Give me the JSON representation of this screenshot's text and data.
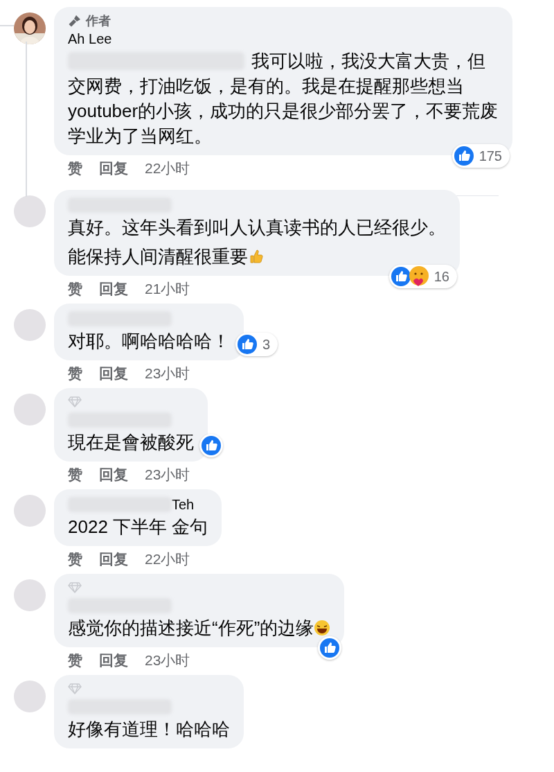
{
  "comments": [
    {
      "badge": {
        "kind": "author",
        "label": "作者"
      },
      "name": "Ah Lee",
      "redacted_lead": true,
      "paragraphs": [
        {
          "text": "我可以啦，我没大富大贵，但交网费，打油吃饭，是有的。我是在提醒那些想当youtuber的小孩，成功的只是很少部分罢了，不要荒废学业为了当网红。"
        }
      ],
      "actions": [
        "赞",
        "回复"
      ],
      "time": "22小时",
      "reactions": {
        "icons": [
          {
            "kind": "like"
          }
        ],
        "count": "175"
      }
    },
    {
      "name_hidden": true,
      "paragraphs": [
        {
          "text": "真好。这年头看到叫人认真读书的人已经很少。"
        },
        {
          "text": "能保持人间清醒很重要",
          "emoji": {
            "kind": "thumbs-up"
          }
        }
      ],
      "actions": [
        "赞",
        "回复"
      ],
      "time": "21小时",
      "reactions": {
        "icons": [
          {
            "kind": "like"
          },
          {
            "kind": "care"
          }
        ],
        "count": "16"
      }
    },
    {
      "name_hidden": true,
      "paragraphs": [
        {
          "text": "对耶。啊哈哈哈哈！"
        }
      ],
      "actions": [
        "赞",
        "回复"
      ],
      "time": "23小时",
      "reactions": {
        "icons": [
          {
            "kind": "like"
          }
        ],
        "count": "3"
      }
    },
    {
      "badge": {
        "kind": "top_fan"
      },
      "name_hidden": true,
      "paragraphs": [
        {
          "text": "現在是會被酸死"
        }
      ],
      "actions": [
        "赞",
        "回复"
      ],
      "time": "23小时",
      "reactions": {
        "icons": [
          {
            "kind": "like"
          }
        ]
      }
    },
    {
      "name": "Teh",
      "name_hidden": true,
      "paragraphs": [
        {
          "text": "2022 下半年 金句"
        }
      ],
      "actions": [
        "赞",
        "回复"
      ],
      "time": "22小时"
    },
    {
      "badge": {
        "kind": "top_fan"
      },
      "name_hidden": true,
      "paragraphs": [
        {
          "text": "感觉你的描述接近“作死”的边缘",
          "emoji": {
            "kind": "laughing"
          }
        }
      ],
      "actions": [
        "赞",
        "回复"
      ],
      "time": "23小时",
      "reactions": {
        "icons": [
          {
            "kind": "like"
          }
        ]
      }
    },
    {
      "badge": {
        "kind": "top_fan"
      },
      "name_hidden": true,
      "paragraphs": [
        {
          "text": "好像有道理！哈哈哈"
        }
      ]
    }
  ]
}
